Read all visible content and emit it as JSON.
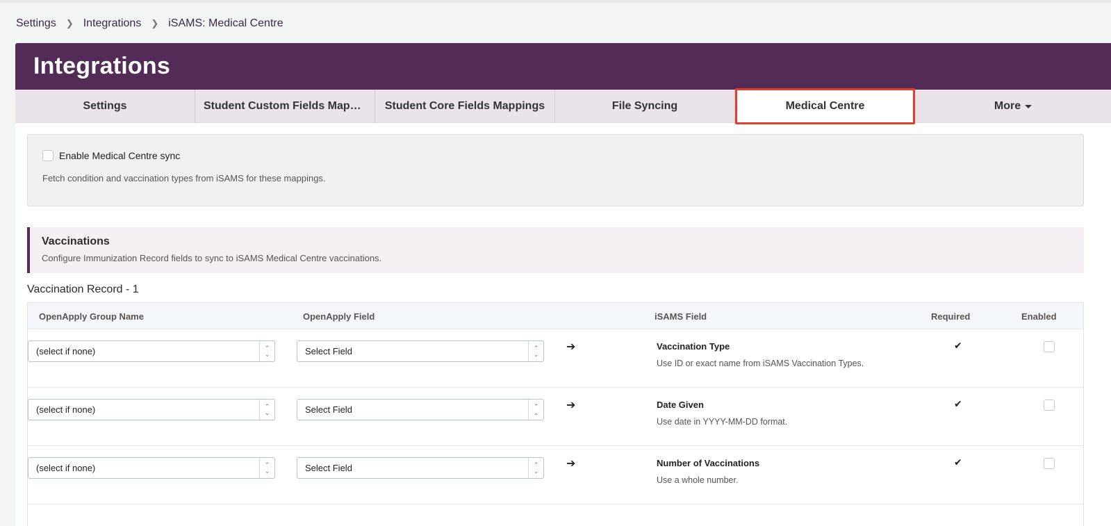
{
  "breadcrumb": {
    "items": [
      "Settings",
      "Integrations",
      "iSAMS: Medical Centre"
    ]
  },
  "header": {
    "title": "Integrations"
  },
  "tabs": [
    {
      "label": "Settings"
    },
    {
      "label": "Student Custom Fields Mappi..."
    },
    {
      "label": "Student Core Fields Mappings"
    },
    {
      "label": "File Syncing"
    },
    {
      "label": "Medical Centre",
      "active": true
    },
    {
      "label": "More"
    }
  ],
  "sync": {
    "checkbox_label": "Enable Medical Centre sync",
    "checked": false,
    "help": "Fetch condition and vaccination types from iSAMS for these mappings."
  },
  "vaccinations": {
    "title": "Vaccinations",
    "description": "Configure Immunization Record fields to sync to iSAMS Medical Centre vaccinations."
  },
  "record": {
    "title": "Vaccination Record - 1",
    "columns": {
      "group_name": "OpenApply Group Name",
      "field": "OpenApply Field",
      "isams_field": "iSAMS Field",
      "required": "Required",
      "enabled": "Enabled"
    },
    "rows": [
      {
        "group_value": "(select if none)",
        "field_value": "Select Field",
        "arrow": "➔",
        "isams_name": "Vaccination Type",
        "isams_help": "Use ID or exact name from iSAMS Vaccination Types.",
        "required_mark": "✔",
        "enabled": false
      },
      {
        "group_value": "(select if none)",
        "field_value": "Select Field",
        "arrow": "➔",
        "isams_name": "Date Given",
        "isams_help": "Use date in YYYY-MM-DD format.",
        "required_mark": "✔",
        "enabled": false
      },
      {
        "group_value": "(select if none)",
        "field_value": "Select Field",
        "arrow": "➔",
        "isams_name": "Number of Vaccinations",
        "isams_help": "Use a whole number.",
        "required_mark": "✔",
        "enabled": false
      }
    ]
  },
  "colors": {
    "brand": "#522c57",
    "active_tab_border": "#e43d2a",
    "tab_bar": "#ebe3ea"
  }
}
